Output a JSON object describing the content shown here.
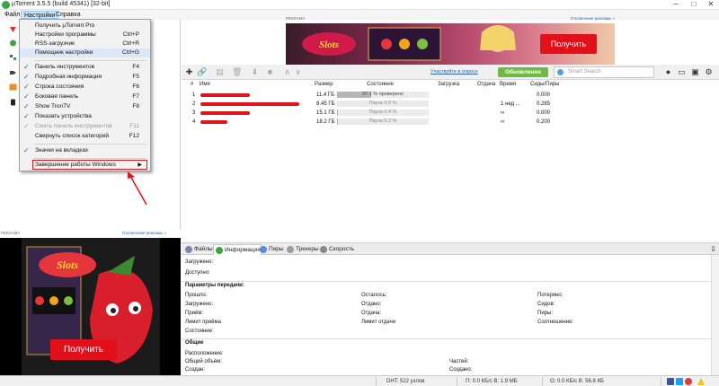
{
  "window": {
    "title": "µTorrent 3.5.5  (build 45341) [32-bit]",
    "controls": [
      "─",
      "□",
      "✕"
    ]
  },
  "menubar": {
    "items": [
      "Файл",
      "Настройки",
      "Справка"
    ]
  },
  "settings_menu": {
    "items": [
      {
        "label": "Получить µTorrent Pro",
        "shortcut": ""
      },
      {
        "label": "Настройки программы",
        "shortcut": "Ctrl+P"
      },
      {
        "label": "RSS-загрузчик",
        "shortcut": "Ctrl+R"
      },
      {
        "label": "Помощник настройки",
        "shortcut": "Ctrl+G"
      },
      {
        "label": "Панель инструментов",
        "shortcut": "F4"
      },
      {
        "label": "Подробная информация",
        "shortcut": "F5"
      },
      {
        "label": "Строка состояния",
        "shortcut": "F6"
      },
      {
        "label": "Боковая панель",
        "shortcut": "F7"
      },
      {
        "label": "Show TronTV",
        "shortcut": "F8"
      },
      {
        "label": "Показать устройства",
        "shortcut": ""
      },
      {
        "label": "Сжать панель инструментов",
        "shortcut": "F11"
      },
      {
        "label": "Свернуть список категорий",
        "shortcut": "F12"
      },
      {
        "label": "Значки на вкладках",
        "shortcut": ""
      },
      {
        "label": "Завершение работы Windows",
        "shortcut": ""
      }
    ],
    "check": "✓",
    "submenu_arrow": "▶"
  },
  "ad_top": {
    "label": "РЕКЛАМА",
    "disable_link": "Отключение рекламы »",
    "button": "Получить"
  },
  "ad_left": {
    "label": "РЕКЛАМА",
    "disable_link": "Отключение рекламы »",
    "button": "Получить"
  },
  "toolbar": {
    "survey_link": "Участвуйте в опросе",
    "update_button": "Обновление",
    "search_placeholder": "Smart Search"
  },
  "torrent_list": {
    "columns": [
      "#",
      "Имя",
      "Размер",
      "Состояние",
      "Загрузка",
      "Отдача",
      "Время",
      "Сиды/Пиры"
    ],
    "rows": [
      {
        "num": "1",
        "size": "11.4 ГБ",
        "status": "37.1 % проверено",
        "progress": 0.371,
        "time": "",
        "seeds": "0.000"
      },
      {
        "num": "2",
        "size": "8.45 ГБ",
        "status": "Пауза 0.0 %",
        "progress": 0.0,
        "time": "1 нед ...",
        "seeds": "0.285"
      },
      {
        "num": "3",
        "size": "15.1 ГБ",
        "status": "Пауза 0.4 %",
        "progress": 0.004,
        "time": "∞",
        "seeds": "0.000"
      },
      {
        "num": "4",
        "size": "18.2 ГБ",
        "status": "Пауза 0.2 %",
        "progress": 0.002,
        "time": "∞",
        "seeds": "0.200"
      }
    ]
  },
  "detail_tabs": [
    "Файлы",
    "Информация",
    "Пиры",
    "Трекеры",
    "Скорость"
  ],
  "info": {
    "downloaded": "Загружено:",
    "available": "Доступно:",
    "transfer_title": "Параметры передачи:",
    "transfer_col1": [
      "Прошло:",
      "Загружено:",
      "Приём:",
      "Лимит приёма",
      "Состояние:"
    ],
    "transfer_col2": [
      "Осталось:",
      "Отдано:",
      "Отдача:",
      "Лимит отдачи"
    ],
    "transfer_col3": [
      "Потеряно:",
      "Сидов:",
      "Пиры:",
      "Соотношение:"
    ],
    "general_title": "Общие",
    "general_col1": [
      "Расположение:",
      "Общий объём:",
      "Создан:"
    ],
    "general_col2": [
      "Частей:",
      "Создано:"
    ]
  },
  "statusbar": {
    "dht": "DHT: 522 узлов",
    "download": "П: 0.0 КБ/с В: 1.9 МБ",
    "upload": "О: 0.0 КБ/с В: 56.8 КБ"
  }
}
